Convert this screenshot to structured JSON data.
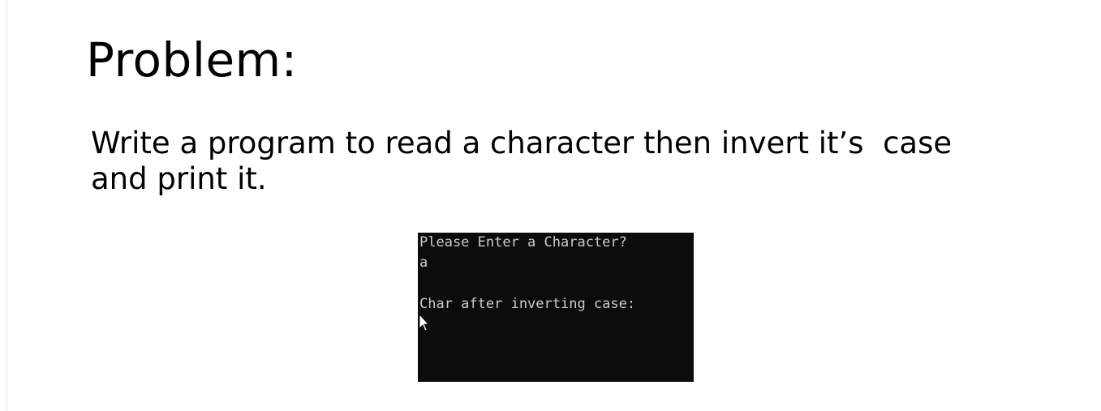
{
  "slide": {
    "title": "Problem:",
    "body_lines": [
      "Write a program to read a character then invert it’s  case",
      "and print it."
    ]
  },
  "console": {
    "lines": [
      "Please Enter a Character?",
      "a",
      "",
      "Char after inverting case:"
    ],
    "background": "#0c0c0c",
    "text_color": "#cccccc"
  },
  "cursor_icon": "mouse-pointer-icon"
}
